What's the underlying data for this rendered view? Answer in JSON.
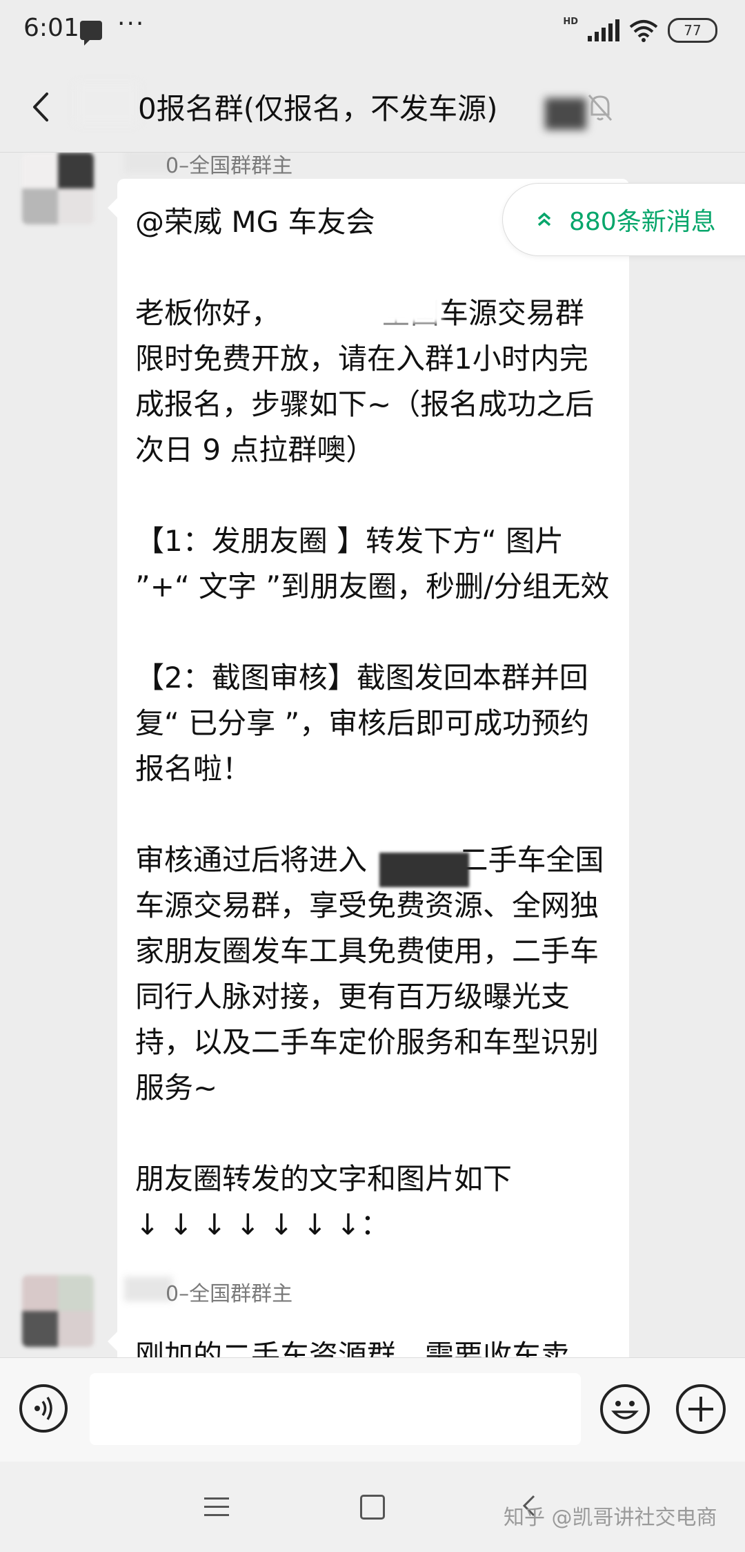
{
  "status_bar": {
    "time": "6:01",
    "dots": "···",
    "hd_label": "HD",
    "battery": "77"
  },
  "header": {
    "title": "0报名群(仅报名，不发车源)"
  },
  "messages": [
    {
      "sender": "0–全国群群主",
      "paragraphs": [
        "@荣威 MG 车友会",
        "老板你好，           全国车源交易群限时免费开放，请在入群1小时内完成报名，步骤如下~（报名成功之后次日 9 点拉群噢）",
        "【1：发朋友圈 】转发下方“ 图片 ”+“ 文字 ”到朋友圈，秒删/分组无效",
        "【2：截图审核】截图发回本群并回复“ 已分享 ”，审核后即可成功预约报名啦！",
        "审核通过后将进入          二手车全国车源交易群，享受免费资源、全网独家朋友圈发车工具免费使用，二手车同行人脉对接，更有百万级曝光支持，以及二手车定价服务和车型识别服务~",
        "朋友圈转发的文字和图片如下\n↓ ↓ ↓ ↓ ↓ ↓ ↓："
      ]
    },
    {
      "sender": "0–全国群群主",
      "paragraphs": [
        "刚加的二手车资源群，需要收车卖"
      ]
    }
  ],
  "new_messages_pill": {
    "label": "880条新消息"
  },
  "input": {
    "placeholder": "",
    "value": ""
  },
  "watermark": "知乎 @凯哥讲社交电商",
  "colors": {
    "accent_green": "#07a66b",
    "background": "#ededed",
    "bubble": "#ffffff"
  }
}
